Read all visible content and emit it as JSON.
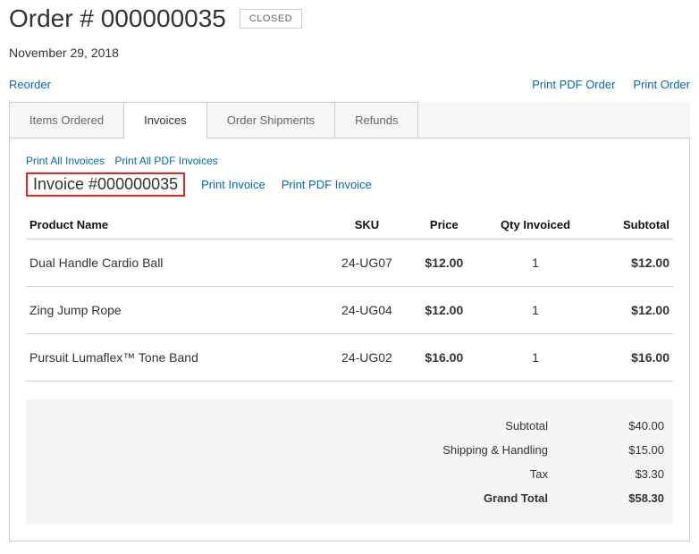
{
  "header": {
    "title": "Order # 000000035",
    "status": "CLOSED",
    "date": "November 29, 2018"
  },
  "actions": {
    "reorder": "Reorder",
    "print_pdf_order": "Print PDF Order",
    "print_order": "Print Order"
  },
  "tabs": {
    "items_ordered": "Items Ordered",
    "invoices": "Invoices",
    "order_shipments": "Order Shipments",
    "refunds": "Refunds"
  },
  "invoice": {
    "print_all": "Print All Invoices",
    "print_all_pdf": "Print All PDF Invoices",
    "title": "Invoice #000000035",
    "print_invoice": "Print Invoice",
    "print_pdf_invoice": "Print PDF Invoice",
    "columns": {
      "product_name": "Product Name",
      "sku": "SKU",
      "price": "Price",
      "qty": "Qty Invoiced",
      "subtotal": "Subtotal"
    },
    "items": [
      {
        "name": "Dual Handle Cardio Ball",
        "sku": "24-UG07",
        "price": "$12.00",
        "qty": "1",
        "subtotal": "$12.00"
      },
      {
        "name": "Zing Jump Rope",
        "sku": "24-UG04",
        "price": "$12.00",
        "qty": "1",
        "subtotal": "$12.00"
      },
      {
        "name": "Pursuit Lumaflex™ Tone Band",
        "sku": "24-UG02",
        "price": "$16.00",
        "qty": "1",
        "subtotal": "$16.00"
      }
    ],
    "totals": {
      "subtotal_label": "Subtotal",
      "subtotal_value": "$40.00",
      "shipping_label": "Shipping & Handling",
      "shipping_value": "$15.00",
      "tax_label": "Tax",
      "tax_value": "$3.30",
      "grand_label": "Grand Total",
      "grand_value": "$58.30"
    }
  }
}
